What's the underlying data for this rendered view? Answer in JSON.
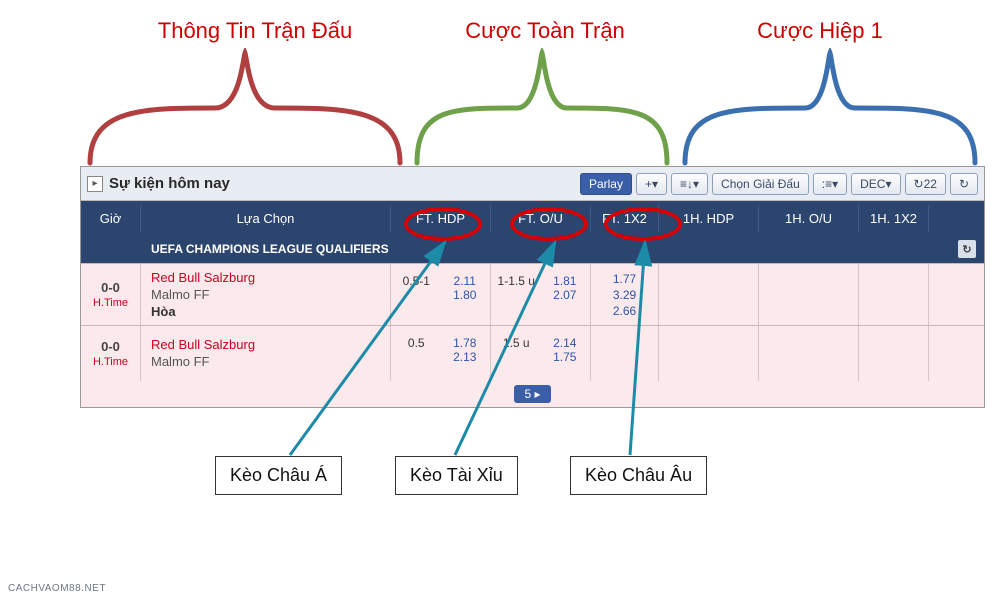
{
  "annotations": {
    "top": {
      "match_info": "Thông  Tin Trận Đấu",
      "full_time": "Cược Toàn Trận",
      "first_half": "Cược Hiệp 1"
    },
    "bottom": {
      "asian": "Kèo Châu Á",
      "over_under": "Kèo Tài Xỉu",
      "euro": "Kèo Châu Âu"
    }
  },
  "panel": {
    "title": "Sự kiện hôm nay",
    "toolbar": {
      "parlay": "Parlay",
      "add": "+",
      "sort": "≡↓",
      "choose_league": "Chọn Giải Đấu",
      "view": ":≡",
      "month": "DEC",
      "refresh_count": "22",
      "refresh_icon": "↻"
    }
  },
  "columns": {
    "time": "Giờ",
    "selection": "Lựa Chọn",
    "ft_hdp": "FT. HDP",
    "ft_ou": "FT. O/U",
    "ft_1x2": "FT. 1X2",
    "h1_hdp": "1H. HDP",
    "h1_ou": "1H. O/U",
    "h1_1x2": "1H. 1X2"
  },
  "league": {
    "name": "UEFA CHAMPIONS LEAGUE QUALIFIERS"
  },
  "matches": [
    {
      "score": "0-0",
      "status": "H.Time",
      "home": "Red Bull Salzburg",
      "away": "Malmo FF",
      "draw": "Hòa",
      "hdp": {
        "line": "0.5-1",
        "home": "2.11",
        "away": "1.80"
      },
      "ou": {
        "line_o": "1-1.5",
        "line_u": "u",
        "over": "1.81",
        "under": "2.07"
      },
      "x2": {
        "h": "1.77",
        "d": "3.29",
        "a": "2.66"
      }
    },
    {
      "score": "0-0",
      "status": "H.Time",
      "home": "Red Bull Salzburg",
      "away": "Malmo FF",
      "draw": "",
      "hdp": {
        "line": "0.5",
        "home": "1.78",
        "away": "2.13"
      },
      "ou": {
        "line_o": "1.5",
        "line_u": "u",
        "over": "2.14",
        "under": "1.75"
      },
      "x2": {
        "h": "",
        "d": "",
        "a": ""
      }
    }
  ],
  "pager": {
    "label": "5 ▸"
  },
  "watermark": "CACHVAOM88.NET"
}
